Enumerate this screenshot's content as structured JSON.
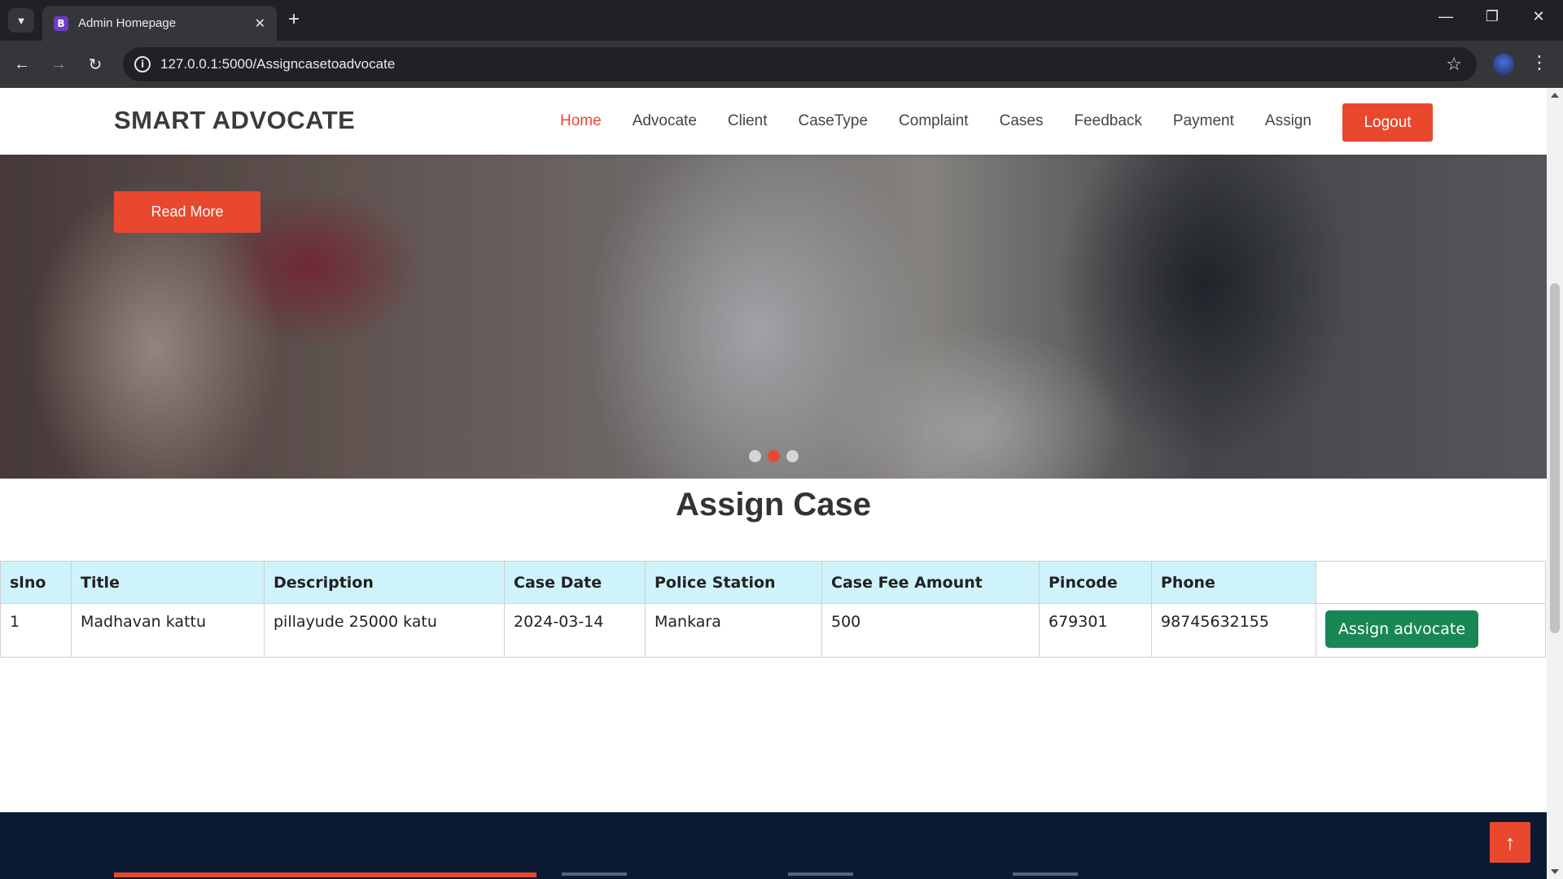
{
  "browser": {
    "tab_title": "Admin Homepage",
    "favicon_letter": "B",
    "url": "127.0.0.1:5000/Assigncasetoadvocate"
  },
  "navbar": {
    "brand": "SMART ADVOCATE",
    "links": [
      "Home",
      "Advocate",
      "Client",
      "CaseType",
      "Complaint",
      "Cases",
      "Feedback",
      "Payment",
      "Assign"
    ],
    "active_link": "Home",
    "logout_label": "Logout"
  },
  "hero": {
    "read_more_label": "Read More",
    "slides": 3,
    "active_slide": 2
  },
  "section": {
    "title": "Assign Case"
  },
  "table": {
    "headers": [
      "slno",
      "Title",
      "Description",
      "Case Date",
      "Police Station",
      "Case Fee Amount",
      "Pincode",
      "Phone",
      ""
    ],
    "rows": [
      {
        "slno": "1",
        "title": "Madhavan kattu",
        "description": "pillayude 25000 katu",
        "case_date": "2024-03-14",
        "police_station": "Mankara",
        "case_fee": "500",
        "pincode": "679301",
        "phone": "98745632155",
        "action_label": "Assign advocate"
      }
    ]
  },
  "colors": {
    "accent": "#e9482f",
    "success": "#198754",
    "table_header": "#cff3fb",
    "footer": "#0b1a33"
  },
  "icons": {
    "back_to_top": "arrow-up-icon"
  }
}
